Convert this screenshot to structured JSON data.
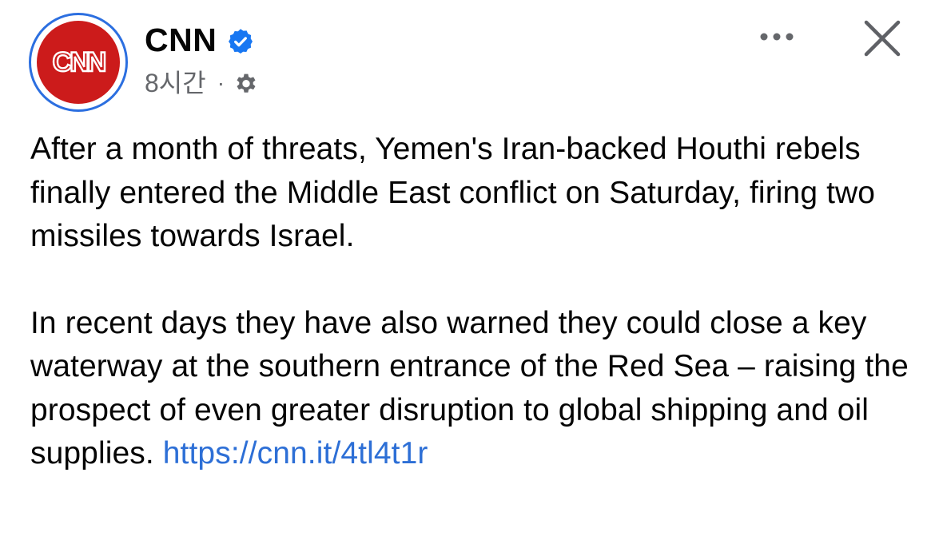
{
  "post": {
    "page_name": "CNN",
    "logo_text": "CNN",
    "timestamp": "8시간",
    "separator": "·",
    "paragraph1": "After a month of threats, Yemen's Iran-backed Houthi rebels finally entered the Middle East conflict on Saturday, firing two missiles towards Israel.",
    "paragraph2": "In recent days they have also warned they could close a key waterway at the southern entrance of the Red Sea – raising the prospect of even greater disruption to global shipping and oil supplies.",
    "link": "https://cnn.it/4tl4t1r"
  },
  "icons": {
    "verified": "verified-badge-icon",
    "privacy": "gear-icon",
    "more": "more-options-icon",
    "close": "close-icon"
  },
  "colors": {
    "brand_red": "#cc1b1b",
    "avatar_ring": "#2c6fe0",
    "verified_blue": "#1877f2",
    "link_blue": "#2d6fd6",
    "secondary_text": "#65676b",
    "primary_text": "#050505"
  }
}
